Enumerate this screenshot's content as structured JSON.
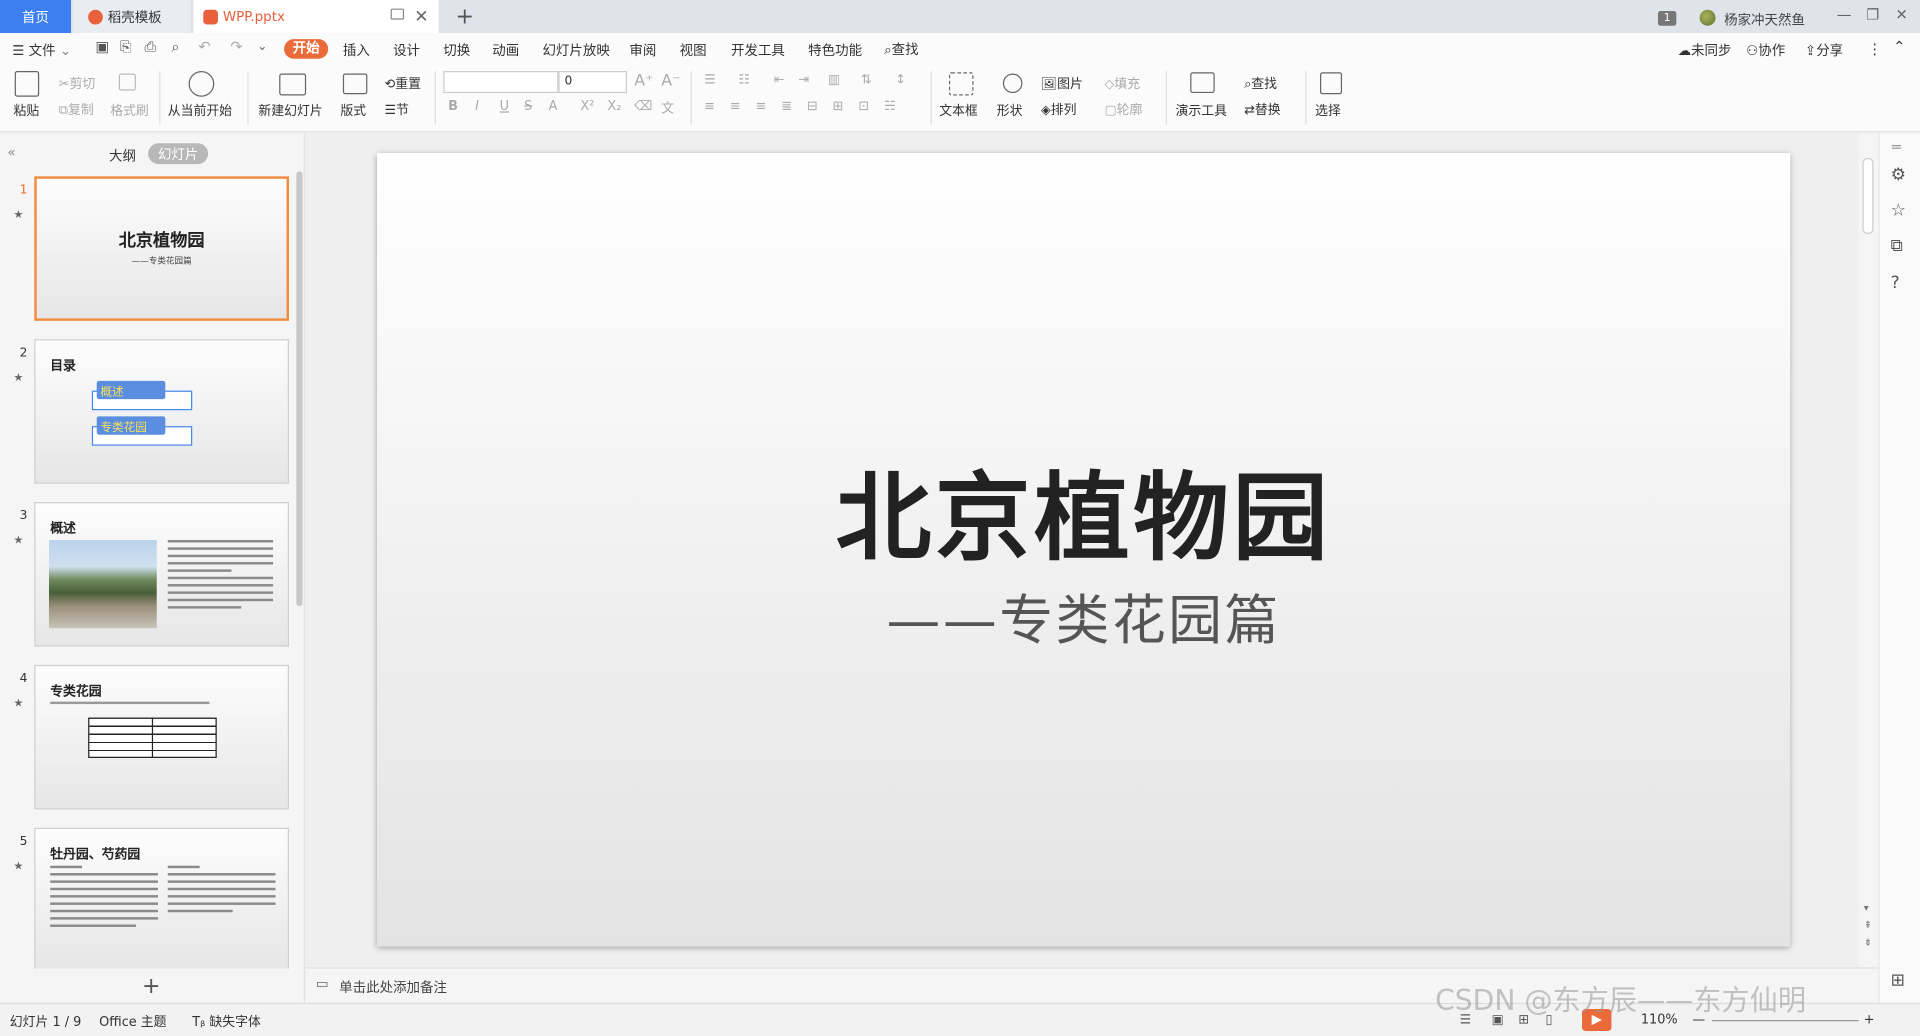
{
  "titlebar": {
    "home_tab": "首页",
    "template_tab": "稻壳模板",
    "file_tab": "WPP.pptx",
    "badge": "1",
    "user_name": "杨家冲天然鱼"
  },
  "menu": {
    "file": "文件",
    "items": [
      "开始",
      "插入",
      "设计",
      "切换",
      "动画",
      "幻灯片放映",
      "审阅",
      "视图",
      "开发工具",
      "特色功能"
    ],
    "search": "查找",
    "sync": "未同步",
    "collab": "协作",
    "share": "分享"
  },
  "ribbon": {
    "paste": "粘贴",
    "cut": "剪切",
    "copy": "复制",
    "format_painter": "格式刷",
    "from_current": "从当前开始",
    "new_slide": "新建幻灯片",
    "layout": "版式",
    "reset": "重置",
    "section": "节",
    "font_size": "0",
    "textbox": "文本框",
    "shape": "形状",
    "picture": "图片",
    "fill": "填充",
    "arrange": "排列",
    "outline": "轮廓",
    "present_tools": "演示工具",
    "find": "查找",
    "replace": "替换",
    "select": "选择"
  },
  "panel": {
    "outline_tab": "大纲",
    "slides_tab": "幻灯片",
    "add_button": "+"
  },
  "thumbnails": [
    {
      "num": "1",
      "title": "北京植物园",
      "subtitle": "——专类花园篇"
    },
    {
      "num": "2",
      "title": "目录",
      "items": [
        "概述",
        "专类花园"
      ]
    },
    {
      "num": "3",
      "title": "概述"
    },
    {
      "num": "4",
      "title": "专类花园"
    },
    {
      "num": "5",
      "title": "牡丹园、芍药园"
    }
  ],
  "slide": {
    "title": "北京植物园",
    "subtitle": "——专类花园篇"
  },
  "notes": {
    "placeholder": "单击此处添加备注"
  },
  "status": {
    "slide_counter": "幻灯片 1 / 9",
    "theme": "Office 主题",
    "missing_font": "缺失字体",
    "zoom": "110%"
  },
  "watermark": "CSDN @东方辰——东方仙明",
  "colors": {
    "accent": "#ea6a3a",
    "home_tab": "#3d7ff0",
    "selected_thumb": "#f28a3f"
  }
}
